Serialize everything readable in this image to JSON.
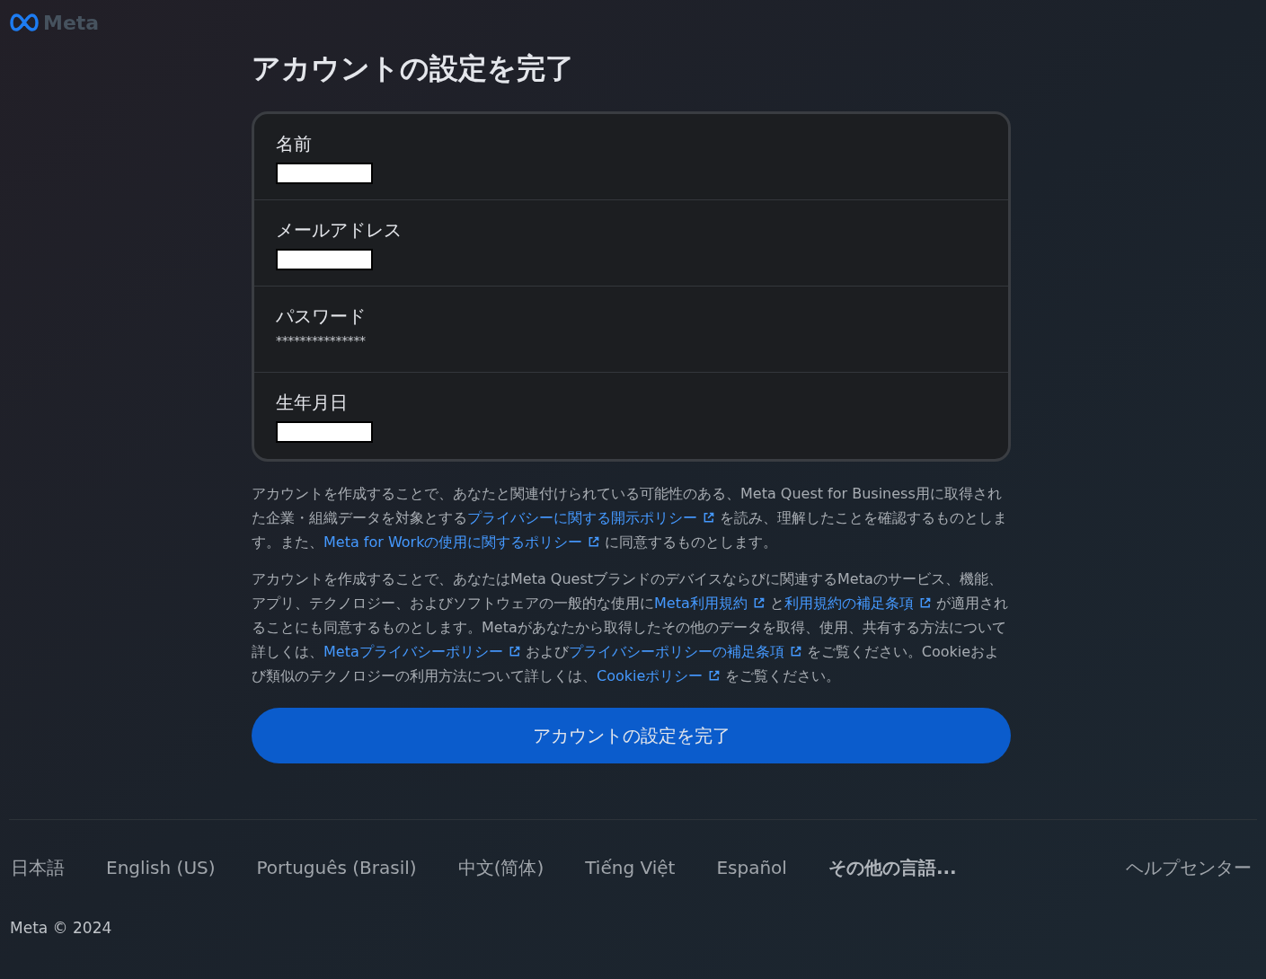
{
  "header": {
    "logo_text": "Meta"
  },
  "title": "アカウントの設定を完了",
  "fields": [
    {
      "label": "名前",
      "kind": "redacted"
    },
    {
      "label": "メールアドレス",
      "kind": "redacted"
    },
    {
      "label": "パスワード",
      "kind": "text",
      "value": "***************"
    },
    {
      "label": "生年月日",
      "kind": "redacted"
    }
  ],
  "paragraphs": [
    [
      {
        "text": "アカウントを作成することで、あなたと関連付けられている可能性のある、Meta Quest for Business用に取得された企業・組織データを対象とする",
        "link": false
      },
      {
        "text": "プライバシーに関する開示ポリシー",
        "link": true
      },
      {
        "text": "を読み、理解したことを確認するものとします。また、",
        "link": false
      },
      {
        "text": "Meta for Workの使用に関するポリシー",
        "link": true
      },
      {
        "text": "に同意するものとします。",
        "link": false
      }
    ],
    [
      {
        "text": "アカウントを作成することで、あなたはMeta Questブランドのデバイスならびに関連するMetaのサービス、機能、アプリ、テクノロジー、およびソフトウェアの一般的な使用に",
        "link": false
      },
      {
        "text": "Meta利用規約",
        "link": true
      },
      {
        "text": "と",
        "link": false
      },
      {
        "text": "利用規約の補足条項",
        "link": true
      },
      {
        "text": "が適用されることにも同意するものとします。Metaがあなたから取得したその他のデータを取得、使用、共有する方法について詳しくは、",
        "link": false
      },
      {
        "text": "Metaプライバシーポリシー",
        "link": true
      },
      {
        "text": "および",
        "link": false
      },
      {
        "text": "プライバシーポリシーの補足条項",
        "link": true
      },
      {
        "text": "をご覧ください。Cookieおよび類似のテクノロジーの利用方法について詳しくは、",
        "link": false
      },
      {
        "text": "Cookieポリシー",
        "link": true
      },
      {
        "text": "をご覧ください。",
        "link": false
      }
    ]
  ],
  "submit_button": "アカウントの設定を完了",
  "footer": {
    "languages": [
      {
        "label": "日本語",
        "bold": false
      },
      {
        "label": "English (US)",
        "bold": false
      },
      {
        "label": "Português (Brasil)",
        "bold": false
      },
      {
        "label": "中文(简体)",
        "bold": false
      },
      {
        "label": "Tiếng Việt",
        "bold": false
      },
      {
        "label": "Español",
        "bold": false
      },
      {
        "label": "その他の言語...",
        "bold": true
      }
    ],
    "help": "ヘルプセンター",
    "copyright": "Meta © 2024"
  }
}
